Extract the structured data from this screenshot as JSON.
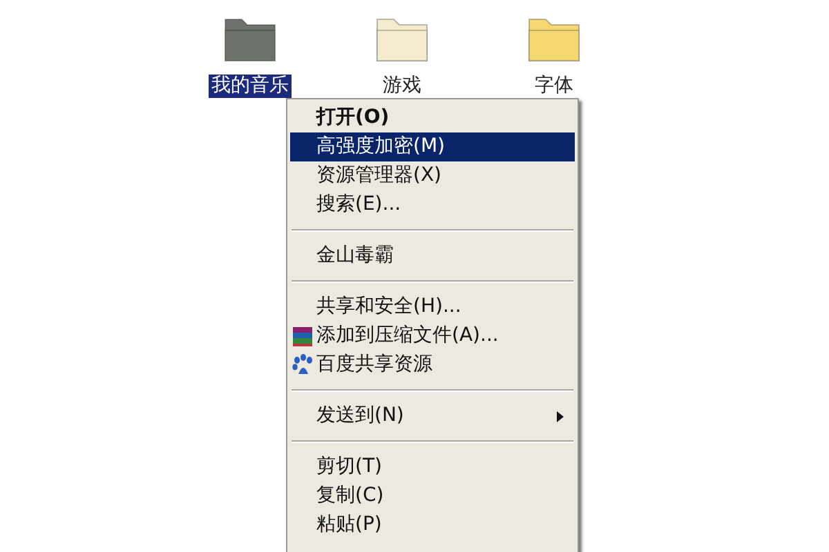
{
  "desktop_icons": [
    {
      "label": "我的音乐",
      "selected": true,
      "color": "#6e726c"
    },
    {
      "label": "游戏",
      "selected": false,
      "color": "#f4eccc"
    },
    {
      "label": "字体",
      "selected": false,
      "color": "#f6d872"
    }
  ],
  "context_menu": {
    "items": [
      {
        "kind": "item",
        "label": "打开(O)",
        "default": true,
        "selected": false
      },
      {
        "kind": "item",
        "label": "高强度加密(M)",
        "default": false,
        "selected": true
      },
      {
        "kind": "item",
        "label": "资源管理器(X)",
        "default": false,
        "selected": false
      },
      {
        "kind": "item",
        "label": "搜索(E)...",
        "default": false,
        "selected": false
      },
      {
        "kind": "separator"
      },
      {
        "kind": "item",
        "label": "金山毒霸",
        "default": false,
        "selected": false
      },
      {
        "kind": "separator"
      },
      {
        "kind": "item",
        "label": "共享和安全(H)...",
        "default": false,
        "selected": false
      },
      {
        "kind": "archive-item",
        "label": "添加到压缩文件(A)...",
        "default": false,
        "selected": false
      },
      {
        "kind": "paw-item",
        "label": "百度共享资源",
        "default": false,
        "selected": false
      },
      {
        "kind": "separator"
      },
      {
        "kind": "submenu",
        "label": "发送到(N)",
        "default": false,
        "selected": false
      },
      {
        "kind": "separator"
      },
      {
        "kind": "item",
        "label": "剪切(T)",
        "default": false,
        "selected": false
      },
      {
        "kind": "item",
        "label": "复制(C)",
        "default": false,
        "selected": false
      },
      {
        "kind": "item",
        "label": "粘贴(P)",
        "default": false,
        "selected": false
      }
    ]
  }
}
